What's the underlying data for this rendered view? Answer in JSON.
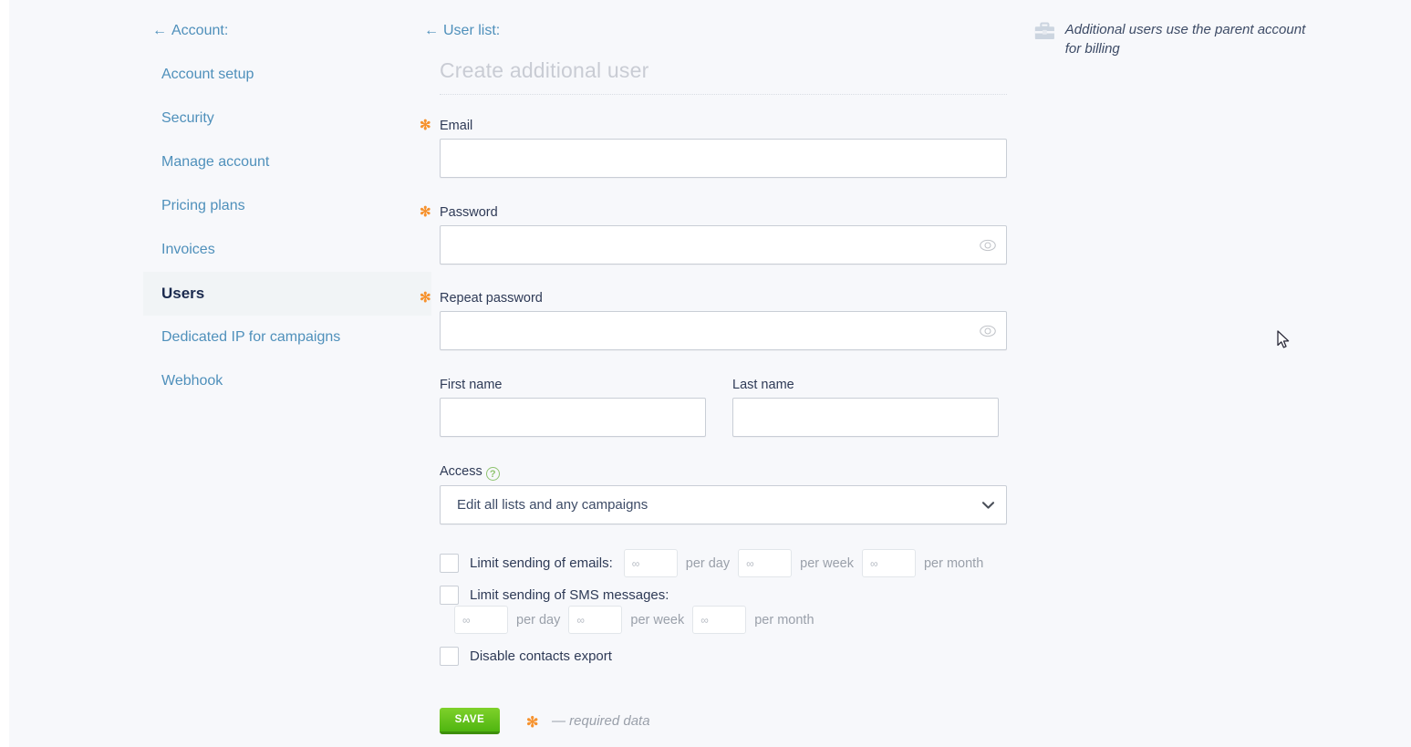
{
  "sidebar": {
    "back_label": "Account:",
    "items": [
      {
        "label": "Account setup",
        "active": false
      },
      {
        "label": "Security",
        "active": false
      },
      {
        "label": "Manage account",
        "active": false
      },
      {
        "label": "Pricing plans",
        "active": false
      },
      {
        "label": "Invoices",
        "active": false
      },
      {
        "label": "Users",
        "active": true
      },
      {
        "label": "Dedicated IP for campaigns",
        "active": false
      },
      {
        "label": "Webhook",
        "active": false
      }
    ]
  },
  "main": {
    "back_label": "User list:",
    "title": "Create additional user",
    "fields": {
      "email": {
        "label": "Email",
        "required_marker": "✻",
        "value": "",
        "placeholder": ""
      },
      "password": {
        "label": "Password",
        "required_marker": "✻",
        "value": "",
        "placeholder": ""
      },
      "repeat_password": {
        "label": "Repeat password",
        "required_marker": "✻",
        "value": "",
        "placeholder": ""
      },
      "first_name": {
        "label": "First name",
        "value": "",
        "placeholder": ""
      },
      "last_name": {
        "label": "Last name",
        "value": "",
        "placeholder": ""
      },
      "access": {
        "label": "Access",
        "help_glyph": "?",
        "selected": "Edit all lists and any campaigns"
      }
    },
    "limits": {
      "emails": {
        "checkbox_label": "Limit sending of emails:",
        "checked": false,
        "per_day_placeholder": "∞",
        "per_day_value": "",
        "per_day_label": "per day",
        "per_week_placeholder": "∞",
        "per_week_value": "",
        "per_week_label": "per week",
        "per_month_placeholder": "∞",
        "per_month_value": "",
        "per_month_label": "per month"
      },
      "sms": {
        "checkbox_label": "Limit sending of SMS messages:",
        "checked": false,
        "per_day_placeholder": "∞",
        "per_day_value": "",
        "per_day_label": "per day",
        "per_week_placeholder": "∞",
        "per_week_value": "",
        "per_week_label": "per week",
        "per_month_placeholder": "∞",
        "per_month_value": "",
        "per_month_label": "per month"
      },
      "disable_export": {
        "checkbox_label": "Disable contacts export",
        "checked": false
      }
    },
    "save_label": "SAVE",
    "required_note_star": "✻",
    "required_note": "— required data"
  },
  "note": {
    "text": "Additional users use the parent account for billing",
    "icon": "briefcase-icon"
  },
  "colors": {
    "link": "#4f90bb",
    "required": "#f6922e",
    "save_button": "#4fb510",
    "help": "#8fc470",
    "active_nav_bg": "#f1f4f6",
    "page_bg": "#f7f8fb"
  }
}
